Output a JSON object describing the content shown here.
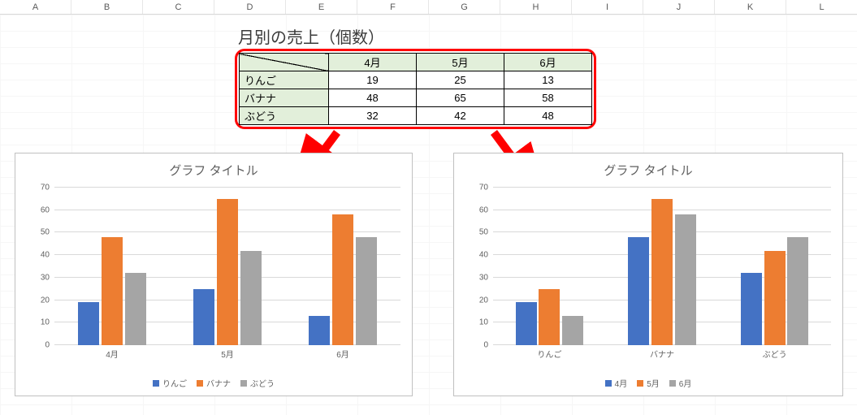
{
  "columns": [
    "A",
    "B",
    "C",
    "D",
    "E",
    "F",
    "G",
    "H",
    "I",
    "J",
    "K",
    "L"
  ],
  "title": "月別の売上（個数）",
  "table": {
    "cols": [
      "4月",
      "5月",
      "6月"
    ],
    "rows": [
      "りんご",
      "バナナ",
      "ぶどう"
    ],
    "data": [
      [
        19,
        25,
        13
      ],
      [
        48,
        65,
        58
      ],
      [
        32,
        42,
        48
      ]
    ]
  },
  "chart_data": [
    {
      "type": "bar",
      "title": "グラフ タイトル",
      "categories": [
        "4月",
        "5月",
        "6月"
      ],
      "series": [
        {
          "name": "りんご",
          "values": [
            19,
            25,
            13
          ]
        },
        {
          "name": "バナナ",
          "values": [
            48,
            65,
            58
          ]
        },
        {
          "name": "ぶどう",
          "values": [
            32,
            42,
            48
          ]
        }
      ],
      "ylim": [
        0,
        70
      ],
      "ystep": 10,
      "xlabel": "",
      "ylabel": ""
    },
    {
      "type": "bar",
      "title": "グラフ タイトル",
      "categories": [
        "りんご",
        "バナナ",
        "ぶどう"
      ],
      "series": [
        {
          "name": "4月",
          "values": [
            19,
            48,
            32
          ]
        },
        {
          "name": "5月",
          "values": [
            25,
            65,
            42
          ]
        },
        {
          "name": "6月",
          "values": [
            13,
            58,
            48
          ]
        }
      ],
      "ylim": [
        0,
        70
      ],
      "ystep": 10,
      "xlabel": "",
      "ylabel": ""
    }
  ],
  "colors": {
    "series1": "#4472c4",
    "series2": "#ed7d31",
    "series3": "#a5a5a5",
    "arrow": "#ff0000"
  }
}
